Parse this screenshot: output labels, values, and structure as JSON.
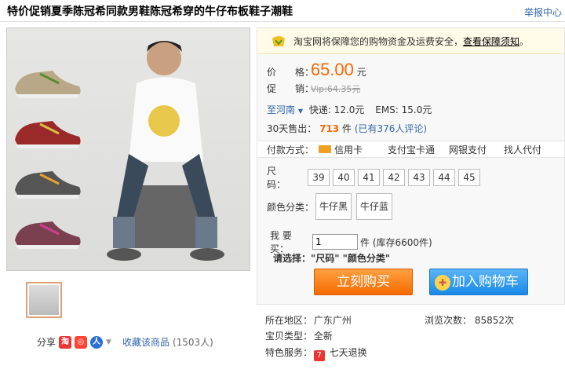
{
  "title": "特价促销夏季陈冠希同款男鞋陈冠希穿的牛仔布板鞋子潮鞋",
  "report_link": "举报中心",
  "guarantee": {
    "text": "淘宝网将保障您的购物资金及运费安全，",
    "link": "查看保障须知",
    "suffix": "。"
  },
  "price": {
    "label": "价　　格：",
    "value": "65.00",
    "unit": "元"
  },
  "promo": {
    "label": "促　　销：",
    "value": "Vip:64.35元"
  },
  "shipping": {
    "region": "至河南",
    "express": "快递: 12.0元",
    "ems": "EMS: 15.0元"
  },
  "sales": {
    "label": "30天售出：",
    "count": "713",
    "unit": "件",
    "reviews": "(已有376人评论)"
  },
  "payment": {
    "label": "付款方式：",
    "methods": [
      "信用卡",
      "支付宝卡通",
      "网银支付",
      "找人代付"
    ]
  },
  "size": {
    "label": "尺　　码：",
    "options": [
      "39",
      "40",
      "41",
      "42",
      "43",
      "44",
      "45"
    ]
  },
  "color": {
    "label": "颜色分类：",
    "options": [
      "牛仔黑",
      "牛仔蓝"
    ]
  },
  "quantity": {
    "label": "我 要 买：",
    "value": "1",
    "stock": "件 (库存6600件)"
  },
  "choose_prompt": "请选择：\"尺码\" \"颜色分类\"",
  "buy_label": "立刻购买",
  "cart_label": "加入购物车",
  "share": {
    "label": "分享",
    "favorite": "收藏该商品",
    "favorite_count": "(1503人)"
  },
  "extra": {
    "location_label": "所在地区：",
    "location": "广东广州",
    "views_label": "浏览次数：",
    "views": "85852次",
    "type_label": "宝贝类型：",
    "type": "全新",
    "service_label": "特色服务：",
    "service": "七天退换",
    "service_icon_text": "7"
  },
  "colors": {
    "accent": "#ff6600",
    "link": "#3366aa",
    "buy": "#f56a00",
    "cart": "#1a8ae8"
  }
}
